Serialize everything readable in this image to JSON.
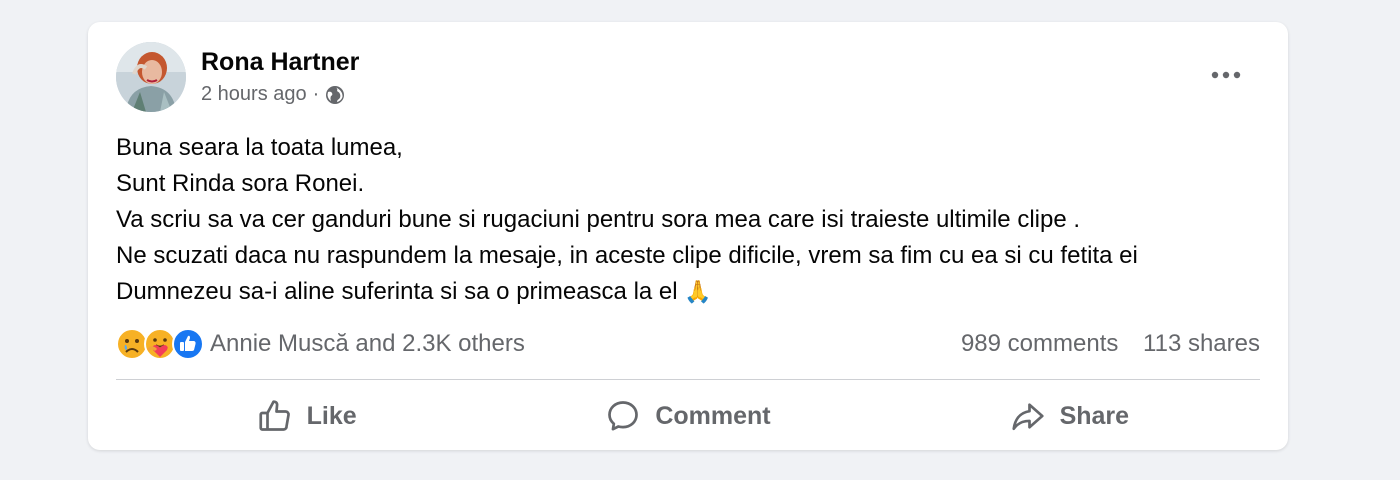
{
  "post": {
    "author": "Rona Hartner",
    "time": "2 hours ago",
    "separator": "·",
    "privacy_icon": "globe-icon",
    "body_lines": [
      "Buna seara la toata lumea,",
      "Sunt Rinda sora Ronei.",
      "Va scriu sa va cer ganduri bune si rugaciuni pentru sora mea care isi traieste ultimile clipe .",
      "Ne scuzati daca nu raspundem la mesaje, in aceste clipe dificile, vrem sa fim cu ea si cu fetita ei",
      "Dumnezeu sa-i aline suferinta si sa o primeasca la el"
    ],
    "body_emoji": "🙏"
  },
  "stats": {
    "reaction_icons": [
      "sad-reaction-icon",
      "care-reaction-icon",
      "like-reaction-icon"
    ],
    "reactions_text": "Annie Muscă and 2.3K others",
    "comments": "989 comments",
    "shares": "113 shares"
  },
  "actions": {
    "like": "Like",
    "comment": "Comment",
    "share": "Share"
  },
  "colors": {
    "background": "#f0f2f5",
    "card": "#ffffff",
    "text": "#050505",
    "muted": "#65676b",
    "like_blue": "#1877f2",
    "reaction_yellow": "#f7b125"
  }
}
